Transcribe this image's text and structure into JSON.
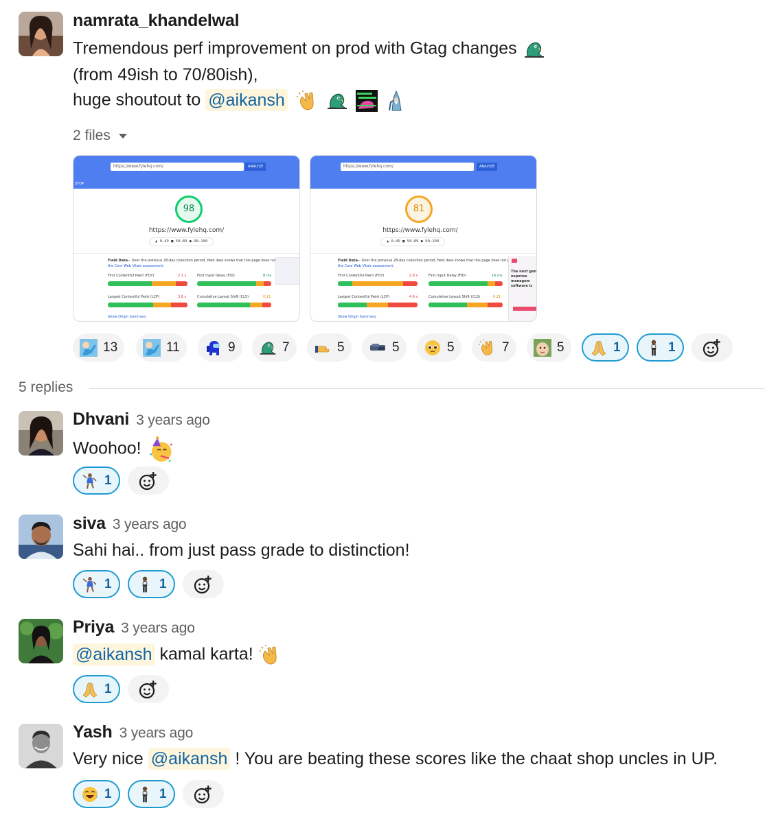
{
  "parent": {
    "author": "namrata_khandelwal",
    "lines": [
      "Tremendous perf improvement on prod with Gtag changes",
      "(from 49ish to 70/80ish),",
      "huge shoutout to"
    ],
    "mention": "@aikansh",
    "files_label": "2 files",
    "attachments": [
      {
        "url": "https://www.fylehq.com/",
        "analyze": "ANALYZE",
        "score": "98",
        "site": "https://www.fylehq.com/",
        "legend": "▲ 0–49   ■ 50–89   ● 90–100",
        "tab": "STOP",
        "field_data": "Field Data",
        "desc": "— Over the previous 28-day collection period, field data shows that this page does not pass",
        "cwv": "the Core Web Vitals assessment.",
        "metrics": [
          {
            "name": "First Contentful Paint (FCP)",
            "value": "2.1 s"
          },
          {
            "name": "First Input Delay (FID)",
            "value": "8 ms"
          },
          {
            "name": "Largest Contentful Paint (LCP)",
            "value": "3.6 s"
          },
          {
            "name": "Cumulative Layout Shift (CLS)",
            "value": "0.11"
          }
        ],
        "summary": "Show Origin Summary"
      },
      {
        "url": "https://www.fylehq.com/",
        "analyze": "ANALYZE",
        "score": "81",
        "site": "https://www.fylehq.com/",
        "legend": "▲ 0–49   ■ 50–89   ● 90–100",
        "field_data": "Field Data",
        "desc": "— Over the previous 28-day collection period, field data shows that this page does not pass",
        "cwv": "the Core Web Vitals assessment.",
        "metrics": [
          {
            "name": "First Contentful Paint (FCP)",
            "value": "2.8 s"
          },
          {
            "name": "First Input Delay (FID)",
            "value": "16 ms"
          },
          {
            "name": "Largest Contentful Paint (LCP)",
            "value": "4.6 s"
          },
          {
            "name": "Cumulative Layout Shift (CLS)",
            "value": "0.21"
          }
        ],
        "summary": "Show Origin Summary",
        "side_text": "The next gen expense managem software is"
      }
    ],
    "reactions": [
      {
        "icon": "blue-man-icon",
        "count": "13"
      },
      {
        "icon": "blue-man-icon",
        "count": "11"
      },
      {
        "icon": "among-us-icon",
        "count": "9"
      },
      {
        "icon": "parrot-icon",
        "count": "7"
      },
      {
        "icon": "pointing-hand-icon",
        "count": "5"
      },
      {
        "icon": "blur-icon",
        "count": "5"
      },
      {
        "icon": "pleading-face-icon",
        "count": "5"
      },
      {
        "icon": "clapping-hands-icon",
        "count": "7"
      },
      {
        "icon": "baby-face-icon",
        "count": "5"
      },
      {
        "icon": "folded-hands-icon",
        "count": "1",
        "selected": true
      },
      {
        "icon": "standing-person-icon",
        "count": "1",
        "selected": true
      }
    ]
  },
  "replies_label": "5 replies",
  "replies": [
    {
      "author": "Dhvani",
      "time": "3 years ago",
      "text": "Woohoo!",
      "reactions": [
        {
          "icon": "dancer-icon",
          "count": "1"
        }
      ]
    },
    {
      "author": "siva",
      "time": "3 years ago",
      "text": "Sahi hai.. from just pass grade to distinction!",
      "reactions": [
        {
          "icon": "dancer-icon",
          "count": "1"
        },
        {
          "icon": "standing-person-icon",
          "count": "1"
        }
      ]
    },
    {
      "author": "Priya",
      "time": "3 years ago",
      "mention": "@aikansh",
      "text": "kamal karta!",
      "reactions": [
        {
          "icon": "folded-hands-icon",
          "count": "1"
        }
      ]
    },
    {
      "author": "Yash",
      "time": "3 years ago",
      "prefix": "Very nice",
      "mention": "@aikansh",
      "text": "! You are beating these scores like the chaat shop uncles in UP.",
      "reactions": [
        {
          "icon": "laughing-icon",
          "count": "1"
        },
        {
          "icon": "standing-person-icon",
          "count": "1"
        }
      ]
    }
  ]
}
